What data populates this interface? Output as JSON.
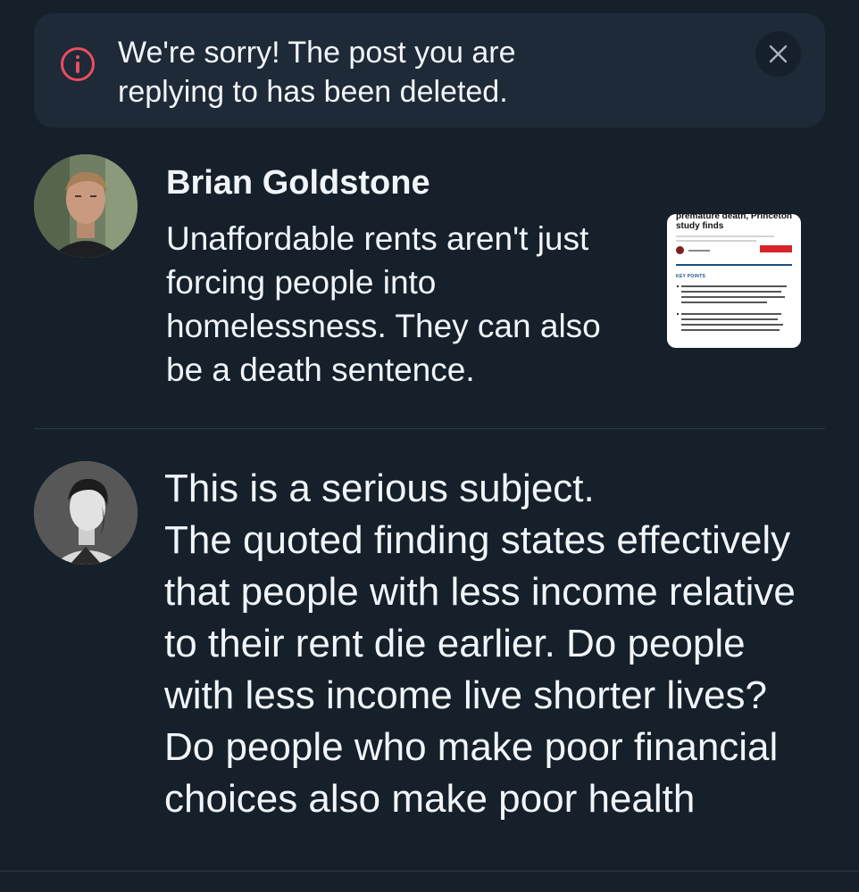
{
  "banner": {
    "message": "We're sorry! The post you are replying to has been deleted.",
    "info_icon": "info-circle-icon",
    "close_icon": "close-icon",
    "accent_color": "#ec4d61"
  },
  "quoted_post": {
    "author_name": "Brian Goldstone",
    "text": "Unaffordable rents aren't just forcing people into homelessness. They can also be a death sentence.",
    "thumbnail": {
      "headline": "premature death, Princeton study finds",
      "author": "Annie Nova",
      "watch_label": "WATCH LIVE",
      "section_label": "KEY POINTS",
      "point_1": "Renters burdened by unaffordable housing costs may be at a higher risk of dying sooner, according to a new study published in the journal Social Science & Medicine.",
      "point_2": "An individual paying 50% of their income toward rent in 2000 was 9% more likely to die over the next 20 years compared with someone paying 30% of their income toward"
    }
  },
  "reply": {
    "text": "This is a serious subject.\nThe quoted finding states effectively that people with less income relative to their rent die earlier. Do people with less income live shorter lives? Do people who make poor financial choices also make poor health"
  },
  "colors": {
    "background": "#15202b",
    "banner_background": "#1e2a38",
    "text": "#f1f5f9",
    "divider": "#2b3744"
  }
}
